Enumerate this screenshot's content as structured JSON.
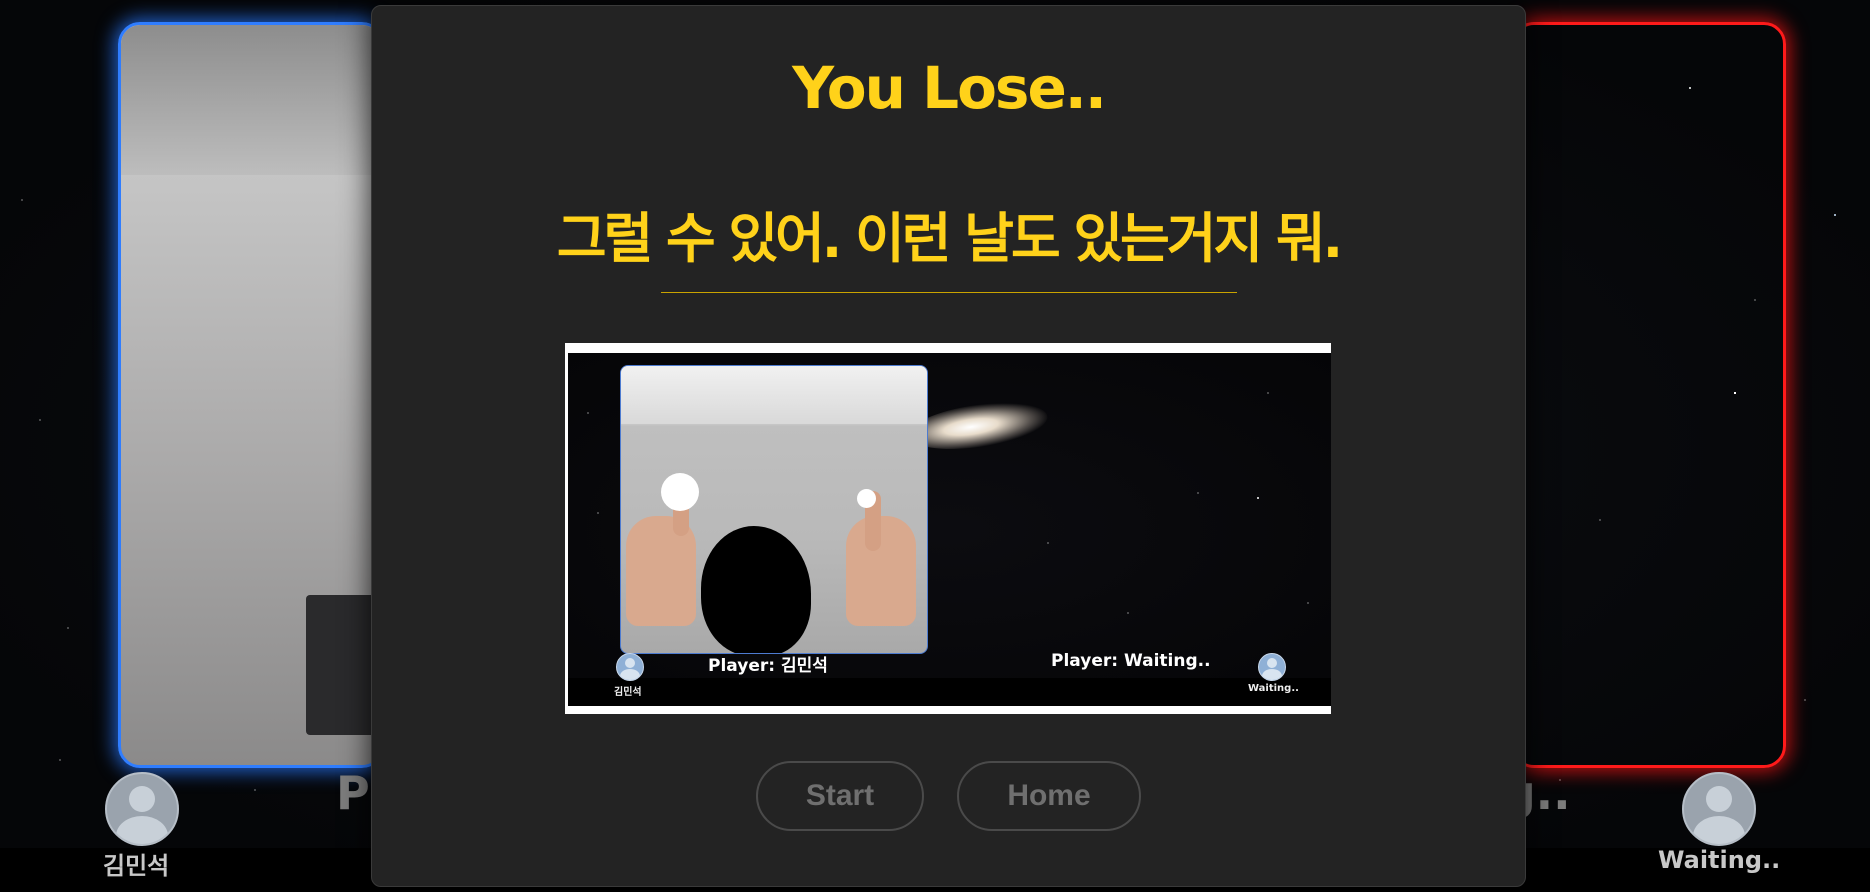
{
  "background": {
    "left_player": {
      "name": "김민석",
      "status_fragment": "P"
    },
    "right_player": {
      "name": "Waiting..",
      "status_fragment": "ng.."
    }
  },
  "modal": {
    "title": "You Lose..",
    "message": "그럴 수 있어. 이런 날도 있는거지 뭐.",
    "capture": {
      "left_player_label": "Player: 김민석",
      "right_player_label": "Player: Waiting..",
      "left_avatar_name": "김민석",
      "right_avatar_name": "Waiting.."
    },
    "buttons": {
      "start": "Start",
      "home": "Home"
    }
  },
  "colors": {
    "accent_yellow": "#ffd21a",
    "left_glow": "#2f7dff",
    "right_glow": "#ff1a1a",
    "modal_bg": "#232323"
  }
}
